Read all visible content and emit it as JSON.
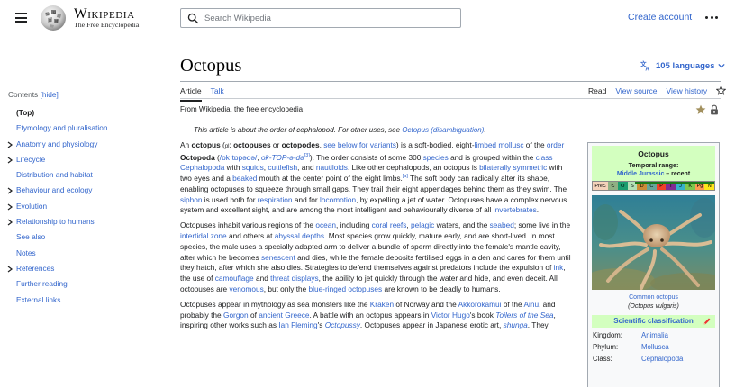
{
  "header": {
    "wordmark_title": "Wikipedia",
    "wordmark_tagline": "The Free Encyclopedia",
    "search_placeholder": "Search Wikipedia",
    "create_account": "Create account"
  },
  "page": {
    "title": "Octopus",
    "languages": "105 languages",
    "tabs_left": [
      "Article",
      "Talk"
    ],
    "tabs_right": [
      "Read",
      "View source",
      "View history"
    ],
    "from_wiki": "From Wikipedia, the free encyclopedia",
    "hatnote_prefix": "This article is about the order of cephalopod. For other uses, see ",
    "hatnote_link": "Octopus (disambiguation)",
    "hatnote_suffix": "."
  },
  "toc": {
    "label": "Contents",
    "hide": "[hide]",
    "items": [
      {
        "label": "(Top)",
        "top": true,
        "caret": false
      },
      {
        "label": "Etymology and pluralisation",
        "caret": false
      },
      {
        "label": "Anatomy and physiology",
        "caret": true
      },
      {
        "label": "Lifecycle",
        "caret": true
      },
      {
        "label": "Distribution and habitat",
        "caret": false
      },
      {
        "label": "Behaviour and ecology",
        "caret": true
      },
      {
        "label": "Evolution",
        "caret": true
      },
      {
        "label": "Relationship to humans",
        "caret": true
      },
      {
        "label": "See also",
        "caret": false
      },
      {
        "label": "Notes",
        "caret": false
      },
      {
        "label": "References",
        "caret": true
      },
      {
        "label": "Further reading",
        "caret": false
      },
      {
        "label": "External links",
        "caret": false
      }
    ]
  },
  "article": {
    "p1": [
      {
        "t": "An "
      },
      {
        "t": "octopus",
        "b": true
      },
      {
        "t": " ("
      },
      {
        "t": "pl",
        "small": true
      },
      {
        "t": ": "
      },
      {
        "t": "octopuses",
        "b": true
      },
      {
        "t": " or "
      },
      {
        "t": "octopodes",
        "b": true
      },
      {
        "t": ", "
      },
      {
        "t": "see below for variants",
        "a": true
      },
      {
        "t": ") is a soft-bodied, eight-"
      },
      {
        "t": "limbed",
        "a": true
      },
      {
        "t": " "
      },
      {
        "t": "mollusc",
        "a": true
      },
      {
        "t": " of the "
      },
      {
        "t": "order",
        "a": true
      },
      {
        "t": " "
      },
      {
        "t": "Octopoda",
        "b": true
      },
      {
        "t": " ("
      },
      {
        "t": "/ɒkˈtɒpədə/",
        "a": true
      },
      {
        "t": ", "
      },
      {
        "t": "ok-TOP-ə-də",
        "a": true,
        "i": true
      },
      {
        "t": "[3]",
        "a": true,
        "sup": true
      },
      {
        "t": "). The order consists of some 300 "
      },
      {
        "t": "species",
        "a": true
      },
      {
        "t": " and is grouped within the "
      },
      {
        "t": "class",
        "a": true
      },
      {
        "t": " "
      },
      {
        "t": "Cephalopoda",
        "a": true
      },
      {
        "t": " with "
      },
      {
        "t": "squids",
        "a": true
      },
      {
        "t": ", "
      },
      {
        "t": "cuttlefish",
        "a": true
      },
      {
        "t": ", and "
      },
      {
        "t": "nautiloids",
        "a": true
      },
      {
        "t": ". Like other cephalopods, an octopus is "
      },
      {
        "t": "bilaterally symmetric",
        "a": true
      },
      {
        "t": " with two eyes and a "
      },
      {
        "t": "beaked",
        "a": true
      },
      {
        "t": " mouth at the center point of the eight limbs."
      },
      {
        "t": "[a]",
        "a": true,
        "sup": true
      },
      {
        "t": " The soft body can radically alter its shape, enabling octopuses to squeeze through small gaps. They trail their eight appendages behind them as they swim. The "
      },
      {
        "t": "siphon",
        "a": true
      },
      {
        "t": " is used both for "
      },
      {
        "t": "respiration",
        "a": true
      },
      {
        "t": " and for "
      },
      {
        "t": "locomotion",
        "a": true
      },
      {
        "t": ", by expelling a jet of water. Octopuses have a complex nervous system and excellent sight, and are among the most intelligent and behaviourally diverse of all "
      },
      {
        "t": "invertebrates",
        "a": true
      },
      {
        "t": "."
      }
    ],
    "p2": [
      {
        "t": "Octopuses inhabit various regions of the "
      },
      {
        "t": "ocean",
        "a": true
      },
      {
        "t": ", including "
      },
      {
        "t": "coral reefs",
        "a": true
      },
      {
        "t": ", "
      },
      {
        "t": "pelagic",
        "a": true
      },
      {
        "t": " waters, and the "
      },
      {
        "t": "seabed",
        "a": true
      },
      {
        "t": "; some live in the "
      },
      {
        "t": "intertidal zone",
        "a": true
      },
      {
        "t": " and others at "
      },
      {
        "t": "abyssal depths",
        "a": true
      },
      {
        "t": ". Most species grow quickly, mature early, and are short-lived. In most species, the male uses a specially adapted arm to deliver a bundle of sperm directly into the female's mantle cavity, after which he becomes "
      },
      {
        "t": "senescent",
        "a": true
      },
      {
        "t": " and dies, while the female deposits fertilised eggs in a den and cares for them until they hatch, after which she also dies. Strategies to defend themselves against predators include the expulsion of "
      },
      {
        "t": "ink",
        "a": true
      },
      {
        "t": ", the use of "
      },
      {
        "t": "camouflage",
        "a": true
      },
      {
        "t": " and "
      },
      {
        "t": "threat displays",
        "a": true
      },
      {
        "t": ", the ability to jet quickly through the water and hide, and even deceit. All octopuses are "
      },
      {
        "t": "venomous",
        "a": true
      },
      {
        "t": ", but only the "
      },
      {
        "t": "blue-ringed octopuses",
        "a": true
      },
      {
        "t": " are known to be deadly to humans."
      }
    ],
    "p3": [
      {
        "t": "Octopuses appear in mythology as sea monsters like the "
      },
      {
        "t": "Kraken",
        "a": true
      },
      {
        "t": " of Norway and the "
      },
      {
        "t": "Akkorokamui",
        "a": true
      },
      {
        "t": " of the "
      },
      {
        "t": "Ainu",
        "a": true
      },
      {
        "t": ", and probably the "
      },
      {
        "t": "Gorgon",
        "a": true
      },
      {
        "t": " of "
      },
      {
        "t": "ancient Greece",
        "a": true
      },
      {
        "t": ". A battle with an octopus appears in "
      },
      {
        "t": "Victor Hugo",
        "a": true
      },
      {
        "t": "'s book "
      },
      {
        "t": "Toilers of the Sea",
        "a": true,
        "i": true
      },
      {
        "t": ", inspiring other works such as "
      },
      {
        "t": "Ian Fleming",
        "a": true
      },
      {
        "t": "'s "
      },
      {
        "t": "Octopussy",
        "a": true,
        "i": true
      },
      {
        "t": ". Octopuses appear in Japanese erotic art, "
      },
      {
        "t": "shunga",
        "a": true,
        "i": true
      },
      {
        "t": ". They"
      }
    ]
  },
  "infobox": {
    "title": "Octopus",
    "range_label": "Temporal range:",
    "range_link": "Middle Jurassic",
    "range_suffix": " – recent",
    "timeline": [
      "PreЄ",
      "Є",
      "O",
      "S",
      "D",
      "C",
      "P",
      "T",
      "J",
      "K",
      "Pg",
      "N"
    ],
    "caption_link": "Common octopus",
    "caption_sci": "(Octopus vulgaris)",
    "sci_class_head": "Scientific classification",
    "rows": [
      {
        "k": "Kingdom:",
        "v": "Animalia"
      },
      {
        "k": "Phylum:",
        "v": "Mollusca"
      },
      {
        "k": "Class:",
        "v": "Cephalopoda"
      }
    ]
  }
}
